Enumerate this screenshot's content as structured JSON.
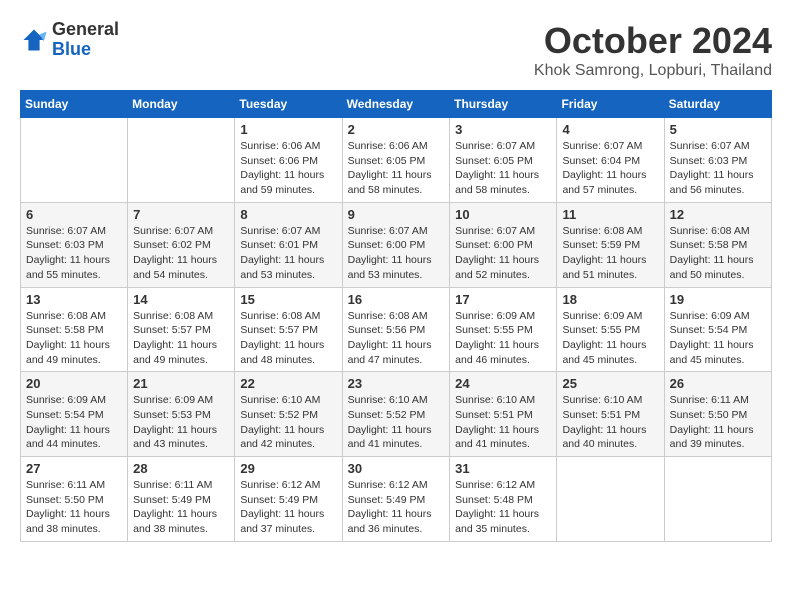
{
  "header": {
    "logo": {
      "general": "General",
      "blue": "Blue"
    },
    "title": "October 2024",
    "location": "Khok Samrong, Lopburi, Thailand"
  },
  "weekdays": [
    "Sunday",
    "Monday",
    "Tuesday",
    "Wednesday",
    "Thursday",
    "Friday",
    "Saturday"
  ],
  "weeks": [
    [
      {
        "day": "",
        "info": ""
      },
      {
        "day": "",
        "info": ""
      },
      {
        "day": "1",
        "sunrise": "6:06 AM",
        "sunset": "6:06 PM",
        "daylight": "11 hours and 59 minutes."
      },
      {
        "day": "2",
        "sunrise": "6:06 AM",
        "sunset": "6:05 PM",
        "daylight": "11 hours and 58 minutes."
      },
      {
        "day": "3",
        "sunrise": "6:07 AM",
        "sunset": "6:05 PM",
        "daylight": "11 hours and 58 minutes."
      },
      {
        "day": "4",
        "sunrise": "6:07 AM",
        "sunset": "6:04 PM",
        "daylight": "11 hours and 57 minutes."
      },
      {
        "day": "5",
        "sunrise": "6:07 AM",
        "sunset": "6:03 PM",
        "daylight": "11 hours and 56 minutes."
      }
    ],
    [
      {
        "day": "6",
        "sunrise": "6:07 AM",
        "sunset": "6:03 PM",
        "daylight": "11 hours and 55 minutes."
      },
      {
        "day": "7",
        "sunrise": "6:07 AM",
        "sunset": "6:02 PM",
        "daylight": "11 hours and 54 minutes."
      },
      {
        "day": "8",
        "sunrise": "6:07 AM",
        "sunset": "6:01 PM",
        "daylight": "11 hours and 53 minutes."
      },
      {
        "day": "9",
        "sunrise": "6:07 AM",
        "sunset": "6:00 PM",
        "daylight": "11 hours and 53 minutes."
      },
      {
        "day": "10",
        "sunrise": "6:07 AM",
        "sunset": "6:00 PM",
        "daylight": "11 hours and 52 minutes."
      },
      {
        "day": "11",
        "sunrise": "6:08 AM",
        "sunset": "5:59 PM",
        "daylight": "11 hours and 51 minutes."
      },
      {
        "day": "12",
        "sunrise": "6:08 AM",
        "sunset": "5:58 PM",
        "daylight": "11 hours and 50 minutes."
      }
    ],
    [
      {
        "day": "13",
        "sunrise": "6:08 AM",
        "sunset": "5:58 PM",
        "daylight": "11 hours and 49 minutes."
      },
      {
        "day": "14",
        "sunrise": "6:08 AM",
        "sunset": "5:57 PM",
        "daylight": "11 hours and 49 minutes."
      },
      {
        "day": "15",
        "sunrise": "6:08 AM",
        "sunset": "5:57 PM",
        "daylight": "11 hours and 48 minutes."
      },
      {
        "day": "16",
        "sunrise": "6:08 AM",
        "sunset": "5:56 PM",
        "daylight": "11 hours and 47 minutes."
      },
      {
        "day": "17",
        "sunrise": "6:09 AM",
        "sunset": "5:55 PM",
        "daylight": "11 hours and 46 minutes."
      },
      {
        "day": "18",
        "sunrise": "6:09 AM",
        "sunset": "5:55 PM",
        "daylight": "11 hours and 45 minutes."
      },
      {
        "day": "19",
        "sunrise": "6:09 AM",
        "sunset": "5:54 PM",
        "daylight": "11 hours and 45 minutes."
      }
    ],
    [
      {
        "day": "20",
        "sunrise": "6:09 AM",
        "sunset": "5:54 PM",
        "daylight": "11 hours and 44 minutes."
      },
      {
        "day": "21",
        "sunrise": "6:09 AM",
        "sunset": "5:53 PM",
        "daylight": "11 hours and 43 minutes."
      },
      {
        "day": "22",
        "sunrise": "6:10 AM",
        "sunset": "5:52 PM",
        "daylight": "11 hours and 42 minutes."
      },
      {
        "day": "23",
        "sunrise": "6:10 AM",
        "sunset": "5:52 PM",
        "daylight": "11 hours and 41 minutes."
      },
      {
        "day": "24",
        "sunrise": "6:10 AM",
        "sunset": "5:51 PM",
        "daylight": "11 hours and 41 minutes."
      },
      {
        "day": "25",
        "sunrise": "6:10 AM",
        "sunset": "5:51 PM",
        "daylight": "11 hours and 40 minutes."
      },
      {
        "day": "26",
        "sunrise": "6:11 AM",
        "sunset": "5:50 PM",
        "daylight": "11 hours and 39 minutes."
      }
    ],
    [
      {
        "day": "27",
        "sunrise": "6:11 AM",
        "sunset": "5:50 PM",
        "daylight": "11 hours and 38 minutes."
      },
      {
        "day": "28",
        "sunrise": "6:11 AM",
        "sunset": "5:49 PM",
        "daylight": "11 hours and 38 minutes."
      },
      {
        "day": "29",
        "sunrise": "6:12 AM",
        "sunset": "5:49 PM",
        "daylight": "11 hours and 37 minutes."
      },
      {
        "day": "30",
        "sunrise": "6:12 AM",
        "sunset": "5:49 PM",
        "daylight": "11 hours and 36 minutes."
      },
      {
        "day": "31",
        "sunrise": "6:12 AM",
        "sunset": "5:48 PM",
        "daylight": "11 hours and 35 minutes."
      },
      {
        "day": "",
        "info": ""
      },
      {
        "day": "",
        "info": ""
      }
    ]
  ],
  "labels": {
    "sunrise": "Sunrise:",
    "sunset": "Sunset:",
    "daylight": "Daylight:"
  }
}
